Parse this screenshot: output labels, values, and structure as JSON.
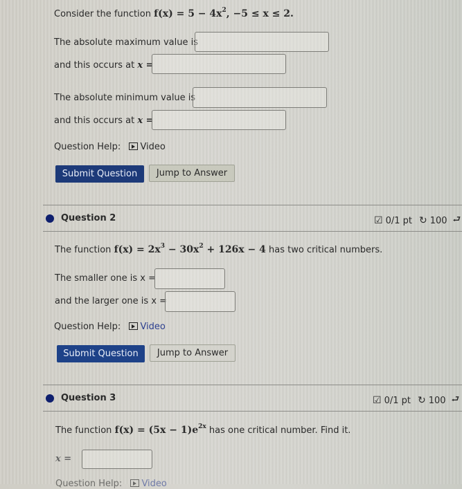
{
  "question1": {
    "intro_text": "Consider the function",
    "function_expr": "f(x) = 5 − 4x², −5 ≤ x ≤ 2.",
    "fx": "f(x) = 5 − 4x",
    "exp": "2",
    "domain": ",   −5 ≤ x ≤ 2.",
    "max_value_label": "The absolute maximum value is",
    "max_value_input": "",
    "max_x_label": "and this occurs at",
    "max_x_var": "x =",
    "max_x_input": "",
    "min_value_label": "The absolute minimum value is",
    "min_value_input": "",
    "min_x_label": "and this occurs at",
    "min_x_var": "x =",
    "min_x_input": "",
    "help_label": "Question Help:",
    "video_label": "Video",
    "submit_label": "Submit Question",
    "jump_label": "Jump to Answer"
  },
  "question2": {
    "title": "Question 2",
    "score": "0/1 pt",
    "retries": "100",
    "prefix": "The function",
    "fx_a": "f(x) = 2x",
    "exp_a": "3",
    "fx_b": " − 30x",
    "exp_b": "2",
    "fx_c": " + 126x − 4",
    "suffix": "has two critical numbers.",
    "smaller_label": "The smaller one is x =",
    "smaller_input": "",
    "larger_label": "and the larger one is x =",
    "larger_input": "",
    "help_label": "Question Help:",
    "video_label": "Video",
    "submit_label": "Submit Question",
    "jump_label": "Jump to Answer"
  },
  "question3": {
    "title": "Question 3",
    "score": "0/1 pt",
    "retries": "100",
    "prefix": "The function",
    "fx": "f(x) = (5x − 1)e",
    "exp": "2x",
    "suffix": "has one critical number. Find it.",
    "x_label": "x =",
    "x_input": "",
    "help_label": "Question Help:",
    "video_label": "Video"
  },
  "colors": {
    "primary_button": "#1d3a79",
    "status_dot": "#0f1f6e",
    "link": "#2c3f8f"
  }
}
